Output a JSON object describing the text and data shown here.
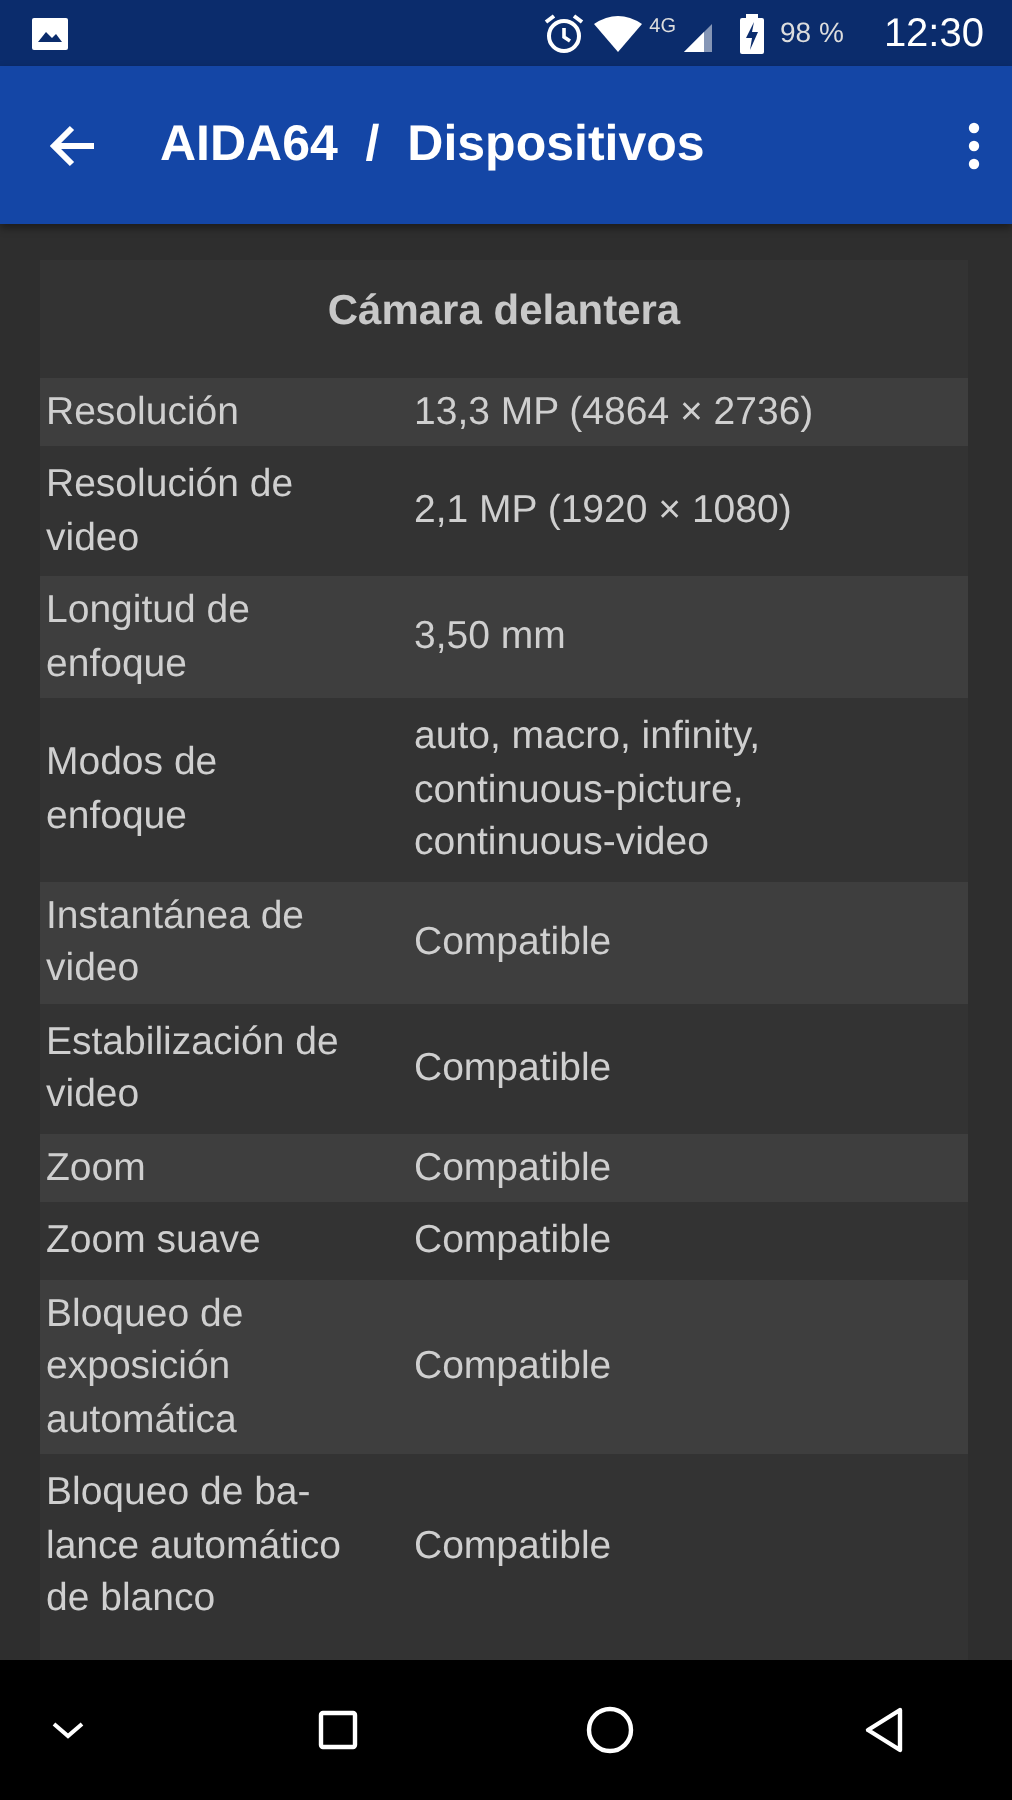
{
  "status_bar": {
    "network": "4G",
    "battery": "98 %",
    "time": "12:30"
  },
  "app_bar": {
    "title": "AIDA64  /  Dispositivos"
  },
  "section": {
    "title": "Cámara delantera"
  },
  "rows": [
    {
      "label": "Resolución",
      "value": "13,3 MP (4864 × 2736)"
    },
    {
      "label": "Resolución de\nvideo",
      "value": "2,1 MP (1920 × 1080)"
    },
    {
      "label": "Longitud de\nenfoque",
      "value": "3,50 mm"
    },
    {
      "label": "Modos de\nenfoque",
      "value": "auto, macro, infinity,\ncontinuous-picture,\ncontinuous-video"
    },
    {
      "label": "Instantánea de\nvideo",
      "value": "Compatible"
    },
    {
      "label": "Estabilización de\nvideo",
      "value": "Compatible"
    },
    {
      "label": "Zoom",
      "value": "Compatible"
    },
    {
      "label": "Zoom suave",
      "value": "Compatible"
    },
    {
      "label": "Bloqueo de\nexposición\nautomática",
      "value": "Compatible"
    },
    {
      "label": "Bloqueo de ba-\nlance automático\nde blanco",
      "value": "Compatible"
    }
  ]
}
